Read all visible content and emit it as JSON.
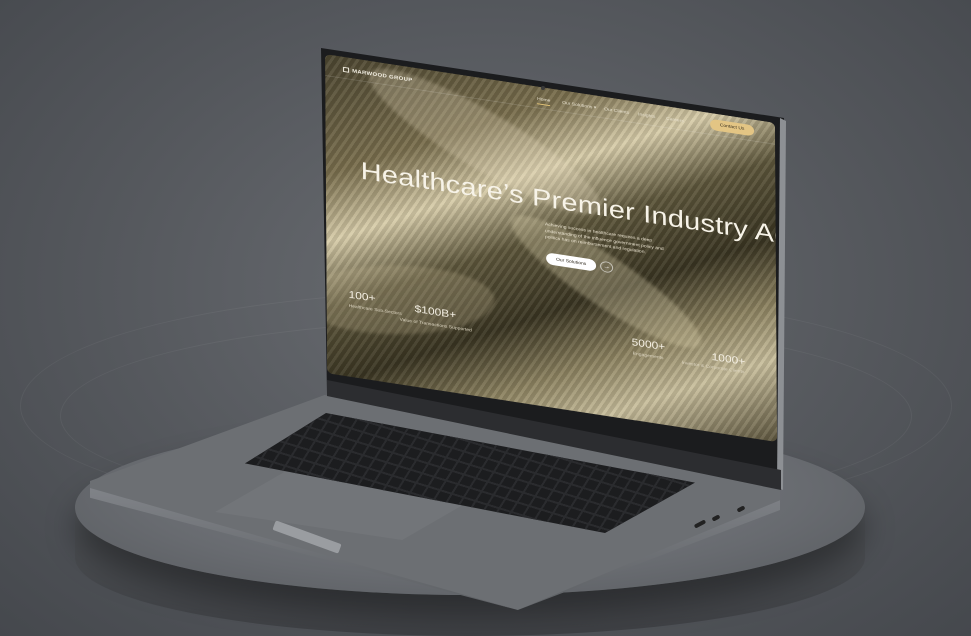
{
  "site": {
    "brand": "MARWOOD GROUP",
    "nav": {
      "items": [
        "Home",
        "Our Solutions",
        "Our Clients",
        "Insights",
        "Careers"
      ],
      "solutions_caret": "▾",
      "contact_label": "Contact Us"
    },
    "hero": {
      "title": "Healthcare’s Premier Industry Advisor",
      "description": "Achieving success in healthcare requires a deep understanding of the influence government policy and politics has on reimbursement and regulation.",
      "cta_label": "Our Solutions",
      "arrow_icon": "→"
    },
    "stats": [
      {
        "value": "100+",
        "label": "Healthcare Sub-Sectors"
      },
      {
        "value": "$100B+",
        "label": "Value of Transactions Supported"
      },
      {
        "value": "5000+",
        "label": "Engagements"
      },
      {
        "value": "1000+",
        "label": "Investor & Corporate Clients"
      }
    ]
  },
  "colors": {
    "accent": "#e3c584",
    "hero_text": "#f7f3e8",
    "background": "#5e6166"
  }
}
